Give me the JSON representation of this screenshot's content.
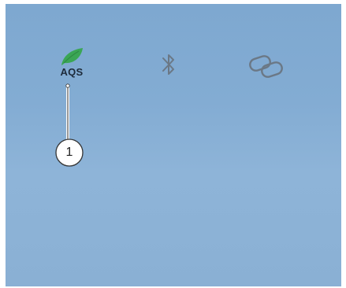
{
  "status_bar": {
    "aqs": {
      "label": "AQS",
      "icon": "leaf-icon",
      "icon_color": "#3aa655"
    },
    "bluetooth": {
      "icon": "bluetooth-icon"
    },
    "link": {
      "icon": "link-icon"
    }
  },
  "callout": {
    "number": "1",
    "target": "aqs-indicator"
  },
  "colors": {
    "background": "#83acd3",
    "icon_gray": "#6b7886",
    "text_dark": "#1d2a3a"
  }
}
